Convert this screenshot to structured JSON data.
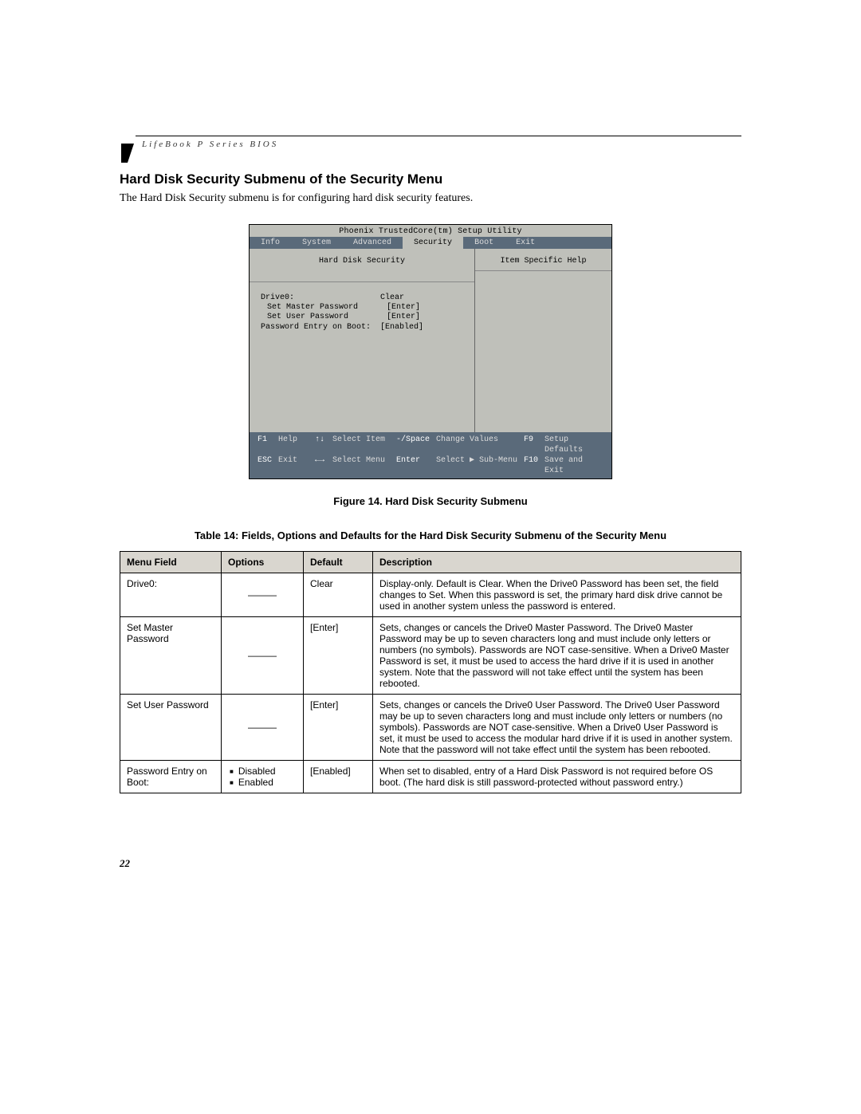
{
  "running_head": "LifeBook P Series BIOS",
  "section_title": "Hard Disk Security Submenu of the Security Menu",
  "intro": "The Hard Disk Security submenu is for configuring hard disk security features.",
  "bios": {
    "title": "Phoenix TrustedCore(tm) Setup Utility",
    "menu": [
      "Info",
      "System",
      "Advanced",
      "Security",
      "Boot",
      "Exit"
    ],
    "active_menu_index": 3,
    "panel_title": "Hard Disk Security",
    "help_title": "Item Specific Help",
    "rows": [
      {
        "label": "Drive0:",
        "value": "Clear",
        "indent": 0
      },
      {
        "label": "Set Master Password",
        "value": "[Enter]",
        "indent": 1
      },
      {
        "label": "Set User Password",
        "value": "[Enter]",
        "indent": 1
      },
      {
        "label": "",
        "value": "",
        "indent": 0
      },
      {
        "label": "Password Entry on Boot:",
        "value": "[Enabled]",
        "indent": 0
      }
    ],
    "footer": {
      "f1": "F1",
      "help": "Help",
      "arr_ud": "↑↓",
      "sel_item": "Select Item",
      "minus": "-/Space",
      "change": "Change Values",
      "f9": "F9",
      "defaults": "Setup Defaults",
      "esc": "ESC",
      "exit": "Exit",
      "arr_lr": "←→",
      "sel_menu": "Select Menu",
      "enter": "Enter",
      "sub": "Select ▶ Sub-Menu",
      "f10": "F10",
      "save": "Save and Exit"
    }
  },
  "figure_caption": "Figure 14.   Hard Disk Security Submenu",
  "table_caption": "Table 14: Fields, Options and Defaults for the Hard Disk Security Submenu of the Security Menu",
  "table": {
    "headers": [
      "Menu Field",
      "Options",
      "Default",
      "Description"
    ],
    "rows": [
      {
        "field": "Drive0:",
        "options_type": "dash",
        "options": [],
        "default": "Clear",
        "desc": "Display-only. Default is Clear. When the Drive0 Password has been set, the field changes to Set. When this password is set, the primary hard disk drive cannot be used in another system unless the password is entered."
      },
      {
        "field": "Set Master Password",
        "options_type": "dash",
        "options": [],
        "default": "[Enter]",
        "desc": "Sets, changes or cancels the Drive0 Master Password. The Drive0 Master Password may be up to seven characters long and must include only letters or numbers (no symbols). Passwords are NOT case-sensitive. When a Drive0 Master Password is set, it must be used to access the hard drive if it is used in another system. Note that the password will not take effect until the system has been rebooted."
      },
      {
        "field": "Set User Password",
        "options_type": "dash",
        "options": [],
        "default": "[Enter]",
        "desc": "Sets, changes or cancels the Drive0 User Password. The Drive0 User Password may be up to seven characters long and must include only letters or numbers (no symbols). Passwords are NOT case-sensitive. When a Drive0 User Password is set, it must be used to access the modular hard drive if it is used in another system. Note that the password will not take effect until the system has been rebooted."
      },
      {
        "field": "Password Entry on Boot:",
        "options_type": "bullets",
        "options": [
          "Disabled",
          "Enabled"
        ],
        "default": "[Enabled]",
        "desc": "When set to disabled, entry of a Hard Disk Password is not required before OS boot. (The hard disk is still password-protected without password entry.)"
      }
    ]
  },
  "page_number": "22"
}
